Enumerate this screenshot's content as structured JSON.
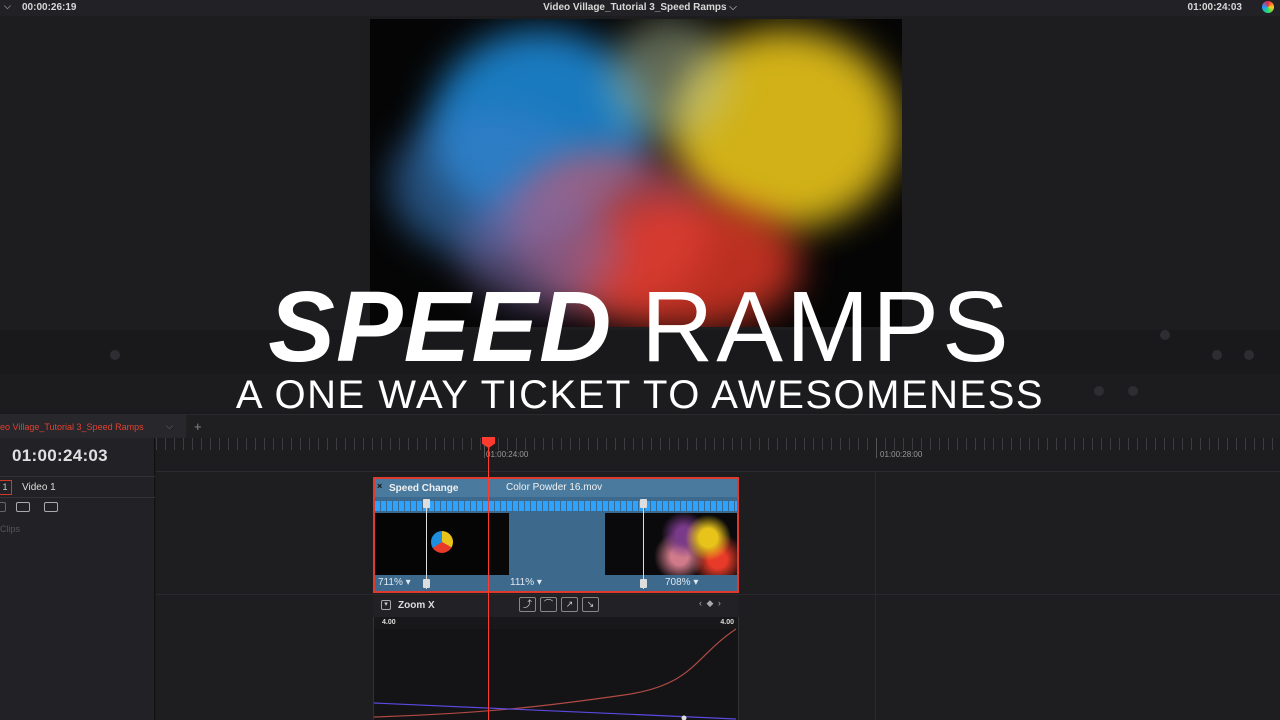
{
  "topbar": {
    "timecode_left": "00:00:26:19",
    "project_title": "Video Village_Tutorial 3_Speed Ramps",
    "title_chevron": "⌵",
    "timecode_right": "01:00:24:03"
  },
  "timeline_tab": {
    "name": "eo Village_Tutorial 3_Speed Ramps",
    "chevron": "⌵",
    "plus": "+"
  },
  "track_header": {
    "timecode": "01:00:24:03",
    "track_number": "1",
    "track_name": "Video 1",
    "clips_label": "Clips"
  },
  "ruler": {
    "label_1": "01:00:24:00",
    "label_2": "01:00:28:00"
  },
  "clip": {
    "close_glyph": "×",
    "speed_label": "Speed Change",
    "name": "Color Powder 16.mov",
    "segments": [
      "711%",
      "111%",
      "708%"
    ]
  },
  "curve_editor": {
    "toggle_glyph": "▾",
    "label": "Zoom X",
    "value_left": "4.00",
    "value_right": "4.00",
    "keyframe_nav": "‹ ◆ ›",
    "buttons": [
      "⤴",
      "⌒",
      "↗",
      "↘"
    ]
  },
  "overlay": {
    "title_bold": "SPEED",
    "title_light": "RAMPS",
    "subtitle": "A ONE WAY TICKET TO AWESOMENESS"
  },
  "colors": {
    "accent_red": "#e03a2e",
    "clip_blue": "#4a7b9f",
    "arrow_blue": "#2da3ff"
  }
}
